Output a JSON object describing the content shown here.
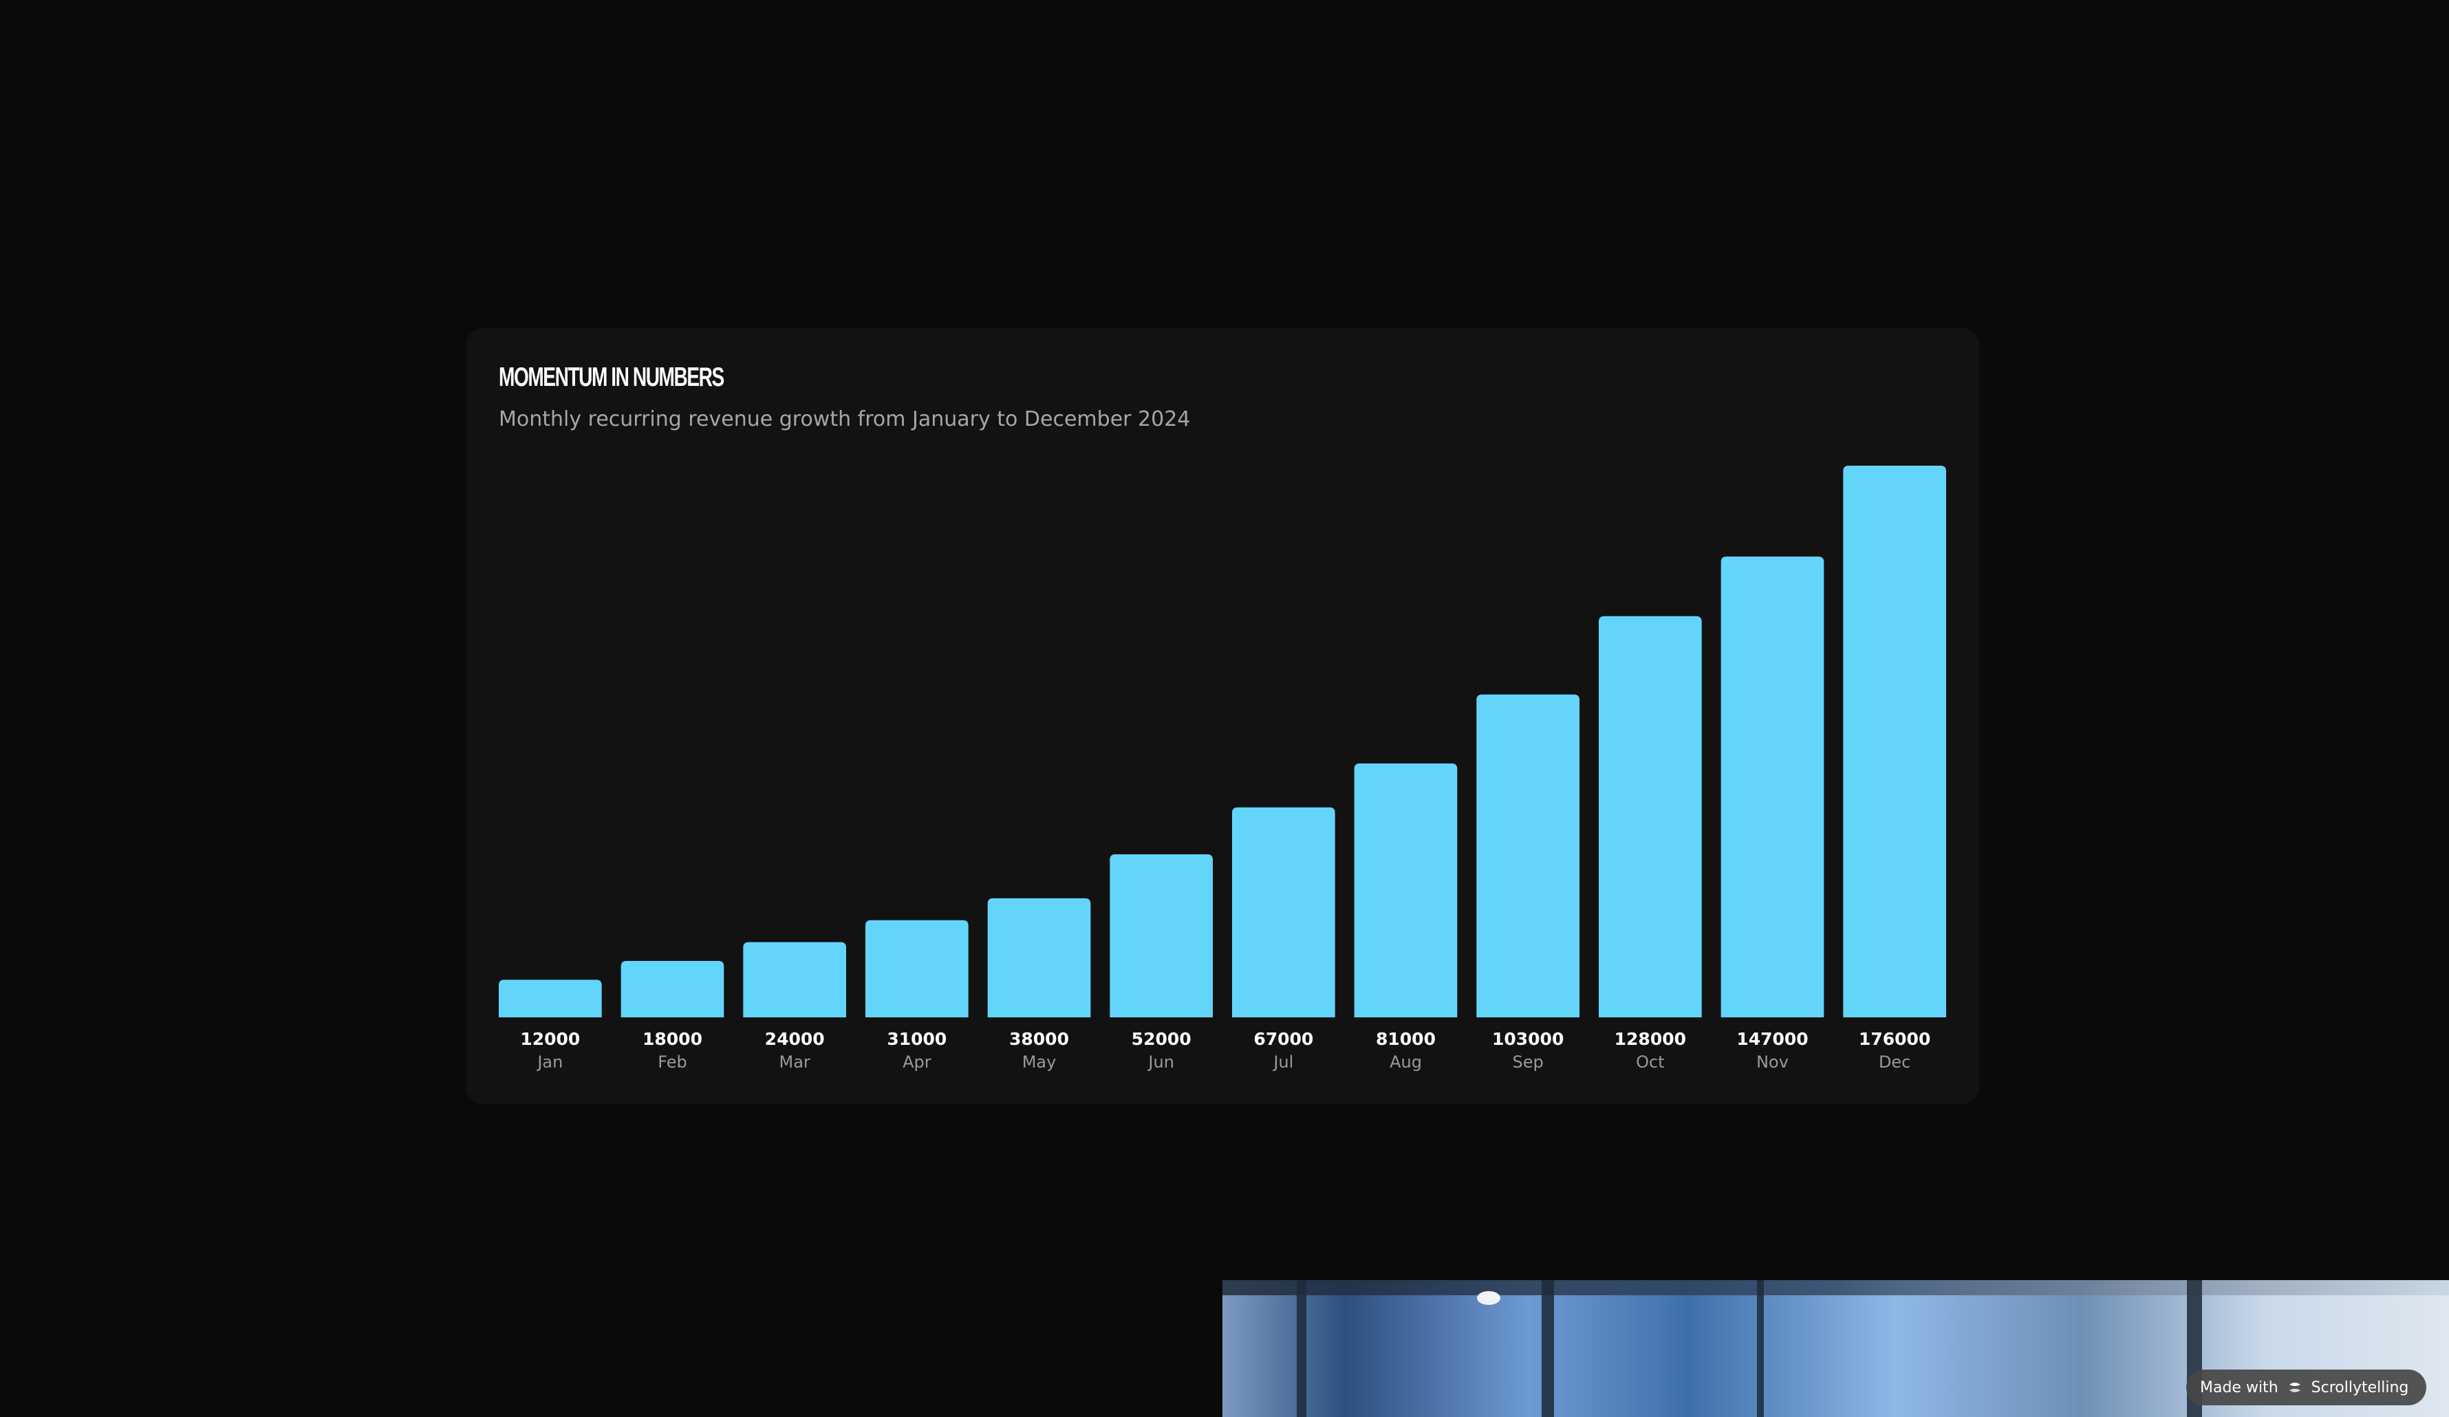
{
  "chart_data": {
    "type": "bar",
    "title": "MOMENTUM IN NUMBERS",
    "subtitle": "Monthly recurring revenue growth from January to December 2024",
    "categories": [
      "Jan",
      "Feb",
      "Mar",
      "Apr",
      "May",
      "Jun",
      "Jul",
      "Aug",
      "Sep",
      "Oct",
      "Nov",
      "Dec"
    ],
    "values": [
      12000,
      18000,
      24000,
      31000,
      38000,
      52000,
      67000,
      81000,
      103000,
      128000,
      147000,
      176000
    ],
    "value_labels": [
      "12000",
      "18000",
      "24000",
      "31000",
      "38000",
      "52000",
      "67000",
      "81000",
      "103000",
      "128000",
      "147000",
      "176000"
    ],
    "ylim": [
      0,
      176000
    ],
    "grid": false,
    "bar_color": "#63d5fb"
  },
  "badge": {
    "prefix": "Made with",
    "brand": "Scrollytelling"
  },
  "colors": {
    "background": "#0a0a0a",
    "card": "#121212",
    "value_label": "#ffffff",
    "category_label": "#9a9a9a"
  }
}
